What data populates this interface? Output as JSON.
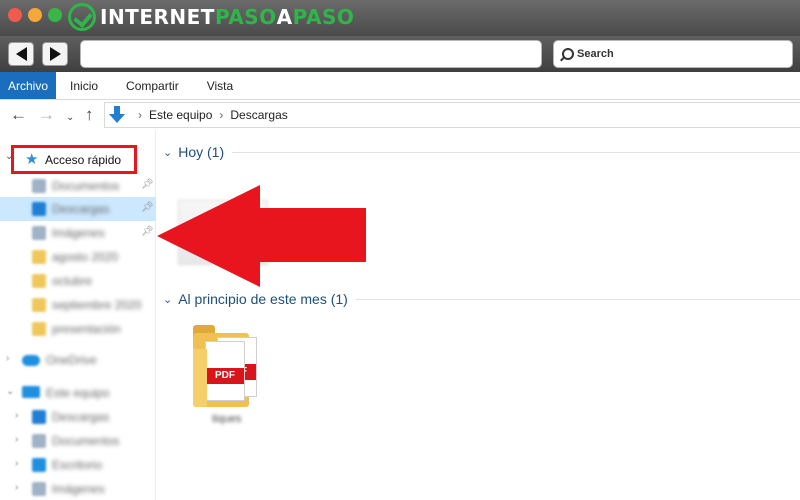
{
  "window": {
    "brand_logo_part1": "INTERNET",
    "brand_logo_part2": "PASO",
    "brand_logo_part3": "A",
    "brand_logo_part4": "PASO"
  },
  "toolbar": {
    "search_placeholder": "Search",
    "back_icon": "triangle-left-icon",
    "forward_icon": "triangle-right-icon"
  },
  "ribbon": {
    "tabs": [
      {
        "label": "Archivo",
        "active": true
      },
      {
        "label": "Inicio"
      },
      {
        "label": "Compartir"
      },
      {
        "label": "Vista"
      }
    ]
  },
  "address": {
    "crumbs": [
      "Este equipo",
      "Descargas"
    ],
    "separator": "›"
  },
  "sidebar": {
    "quick_access_label": "Acceso rápido",
    "items": [
      {
        "label": "Documentos",
        "pinned": true,
        "icon_color": "#9fb2c6"
      },
      {
        "label": "Descargas",
        "pinned": true,
        "selected": true,
        "icon_color": "#1f7fd4"
      },
      {
        "label": "Imágenes",
        "pinned": true,
        "icon_color": "#9fb2c6"
      },
      {
        "label": "agosto 2020",
        "icon_color": "#f0c75a"
      },
      {
        "label": "octubre",
        "icon_color": "#f0c75a"
      },
      {
        "label": "septiembre 2020",
        "icon_color": "#f0c75a"
      },
      {
        "label": "presentación",
        "icon_color": "#f0c75a"
      }
    ],
    "sections": [
      {
        "label": "OneDrive",
        "icon_color": "#1f8fe0"
      },
      {
        "label": "Este equipo",
        "icon_color": "#1f8fe0",
        "expanded": true
      }
    ],
    "subitems": [
      {
        "label": "Descargas",
        "icon_color": "#1f7fd4"
      },
      {
        "label": "Documentos",
        "icon_color": "#9fb2c6"
      },
      {
        "label": "Escritorio",
        "icon_color": "#1f8fe0"
      },
      {
        "label": "Imágenes",
        "icon_color": "#9fb2c6"
      }
    ]
  },
  "content": {
    "groups": [
      {
        "title": "Hoy (1)"
      },
      {
        "title": "Al principio de este mes (1)"
      }
    ],
    "folder_caption": "tiques",
    "pdf_label": "PDF"
  },
  "colors": {
    "accent": "#1a6ebd",
    "highlight_red": "#e8141e",
    "selected_bg": "#cce8ff",
    "brand_green": "#2fb54a"
  }
}
